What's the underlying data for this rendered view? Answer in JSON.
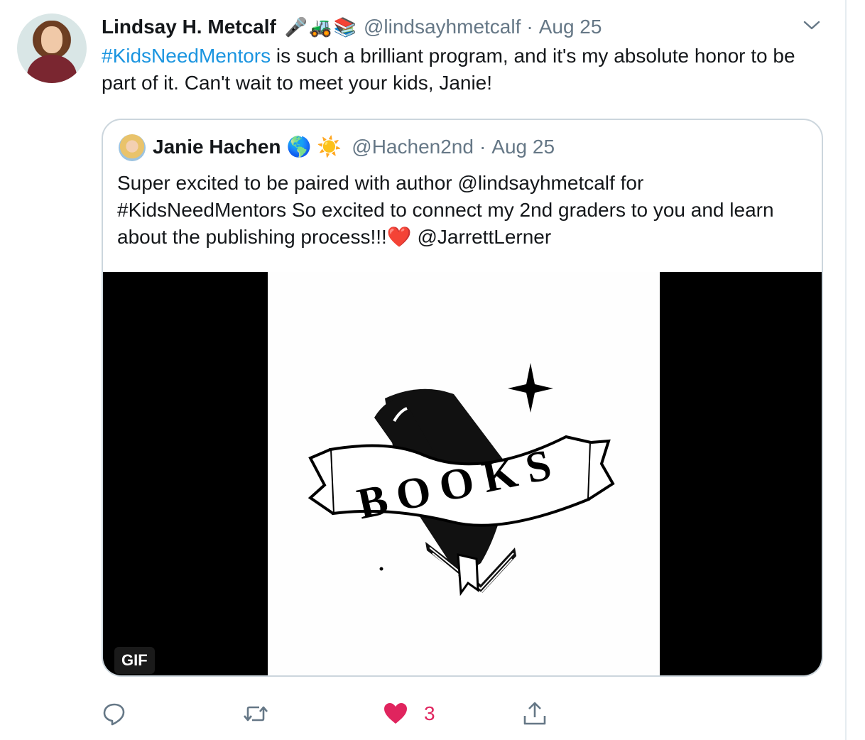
{
  "tweet": {
    "display_name": "Lindsay H. Metcalf",
    "name_emojis": [
      "🎤",
      "🚜",
      "📚"
    ],
    "handle": "@lindsayhmetcalf",
    "separator": "·",
    "date": "Aug 25",
    "text_hashtag": "#KidsNeedMentors",
    "text_rest": " is such a brilliant program, and it's my absolute honor to be part of it. Can't wait to meet your kids, Janie!"
  },
  "quoted": {
    "display_name": "Janie Hachen",
    "name_emojis": [
      "🌎",
      "☀️"
    ],
    "handle": "@Hachen2nd",
    "separator": "·",
    "date": "Aug 25",
    "text": "Super excited to be paired with author @lindsayhmetcalf for #KidsNeedMentors So excited to connect my 2nd graders to you and learn about the publishing process!!!",
    "heart_emoji": "❤️",
    "text_tail": "  @JarrettLerner",
    "media": {
      "badge": "GIF",
      "banner_text": "BOOKS"
    }
  },
  "actions": {
    "like_count": "3",
    "like_color": "#e0245e",
    "icons": [
      "reply-icon",
      "retweet-icon",
      "heart-icon",
      "share-icon"
    ]
  },
  "colors": {
    "link": "#1b95e0",
    "secondary_text": "#657786",
    "border": "#ccd6dd"
  }
}
